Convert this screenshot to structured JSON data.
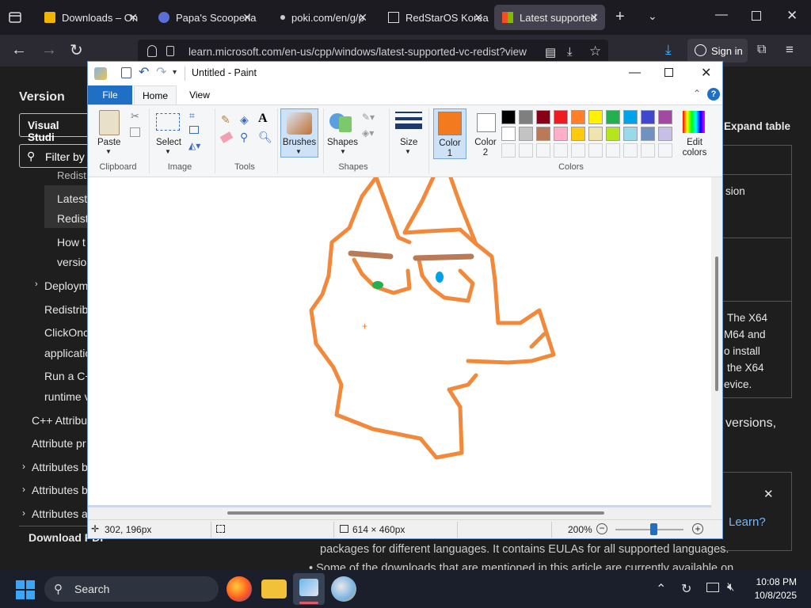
{
  "browser": {
    "tabs": [
      {
        "label": "Downloads – On"
      },
      {
        "label": "Papa's Scooperia"
      },
      {
        "label": "poki.com/en/g/p"
      },
      {
        "label": "RedStarOS Korea"
      },
      {
        "label": "Latest supported"
      }
    ],
    "url": "learn.microsoft.com/en-us/cpp/windows/latest-supported-vc-redist?view",
    "sign_in": "Sign in"
  },
  "page": {
    "sidebar_heading": "Version",
    "version_select": "Visual Studi",
    "filter_placeholder": "Filter by",
    "nav": [
      {
        "label": "Redist"
      },
      {
        "label": "Latest"
      },
      {
        "label": "Redist"
      },
      {
        "label": "How t"
      },
      {
        "label": "versio"
      },
      {
        "label": "Deploym"
      },
      {
        "label": "Redistrib"
      },
      {
        "label": "ClickOnc"
      },
      {
        "label": "applicatio"
      },
      {
        "label": "Run a C+"
      },
      {
        "label": "runtime v"
      },
      {
        "label": "C++ Attribu"
      },
      {
        "label": "Attribute pr"
      },
      {
        "label": "Attributes b"
      },
      {
        "label": "Attributes b"
      },
      {
        "label": "Attributes a"
      }
    ],
    "download_pdf": "Download PDF",
    "expand_table": "Expand table",
    "right_texts": {
      "sion": "sion",
      "x64_1": "The X64",
      "x64_2": "M64 and",
      "x64_3": "o install",
      "x64_4": "the X64",
      "x64_5": "evice.",
      "versions": "versions,",
      "learn": "Learn?",
      "bottom_1": "packages for different languages. It contains EULAs for all supported languages.",
      "bottom_2": "Some of the downloads that are mentioned in this article are currently available on"
    }
  },
  "paint": {
    "title": "Untitled - Paint",
    "tabs": {
      "file": "File",
      "home": "Home",
      "view": "View"
    },
    "ribbon": {
      "paste": "Paste",
      "select": "Select",
      "brushes": "Brushes",
      "shapes": "Shapes",
      "size": "Size",
      "color1": "Color\n1",
      "color1_a": "Color",
      "color1_b": "1",
      "color2_a": "Color",
      "color2_b": "2",
      "edit_colors_a": "Edit",
      "edit_colors_b": "colors",
      "groups": {
        "clipboard": "Clipboard",
        "image": "Image",
        "tools": "Tools",
        "shapes": "Shapes",
        "colors": "Colors"
      }
    },
    "colors": {
      "color1": "#f47a20",
      "color2": "#ffffff",
      "stroke": "#f2883a",
      "row1": [
        "#000000",
        "#7f7f7f",
        "#880015",
        "#ed1c24",
        "#ff7f27",
        "#fff200",
        "#22b14c",
        "#00a2e8",
        "#3f48cc",
        "#a349a4"
      ],
      "row2": [
        "#ffffff",
        "#c3c3c3",
        "#b97a57",
        "#ffaec9",
        "#ffc90e",
        "#efe4b0",
        "#b5e61d",
        "#99d9ea",
        "#7092be",
        "#c8bfe7"
      ]
    },
    "status": {
      "cursor": "302, 196px",
      "size": "614 × 460px",
      "zoom": "200%"
    }
  },
  "taskbar": {
    "search": "Search",
    "time": "10:08 PM",
    "date": "10/8/2025"
  }
}
